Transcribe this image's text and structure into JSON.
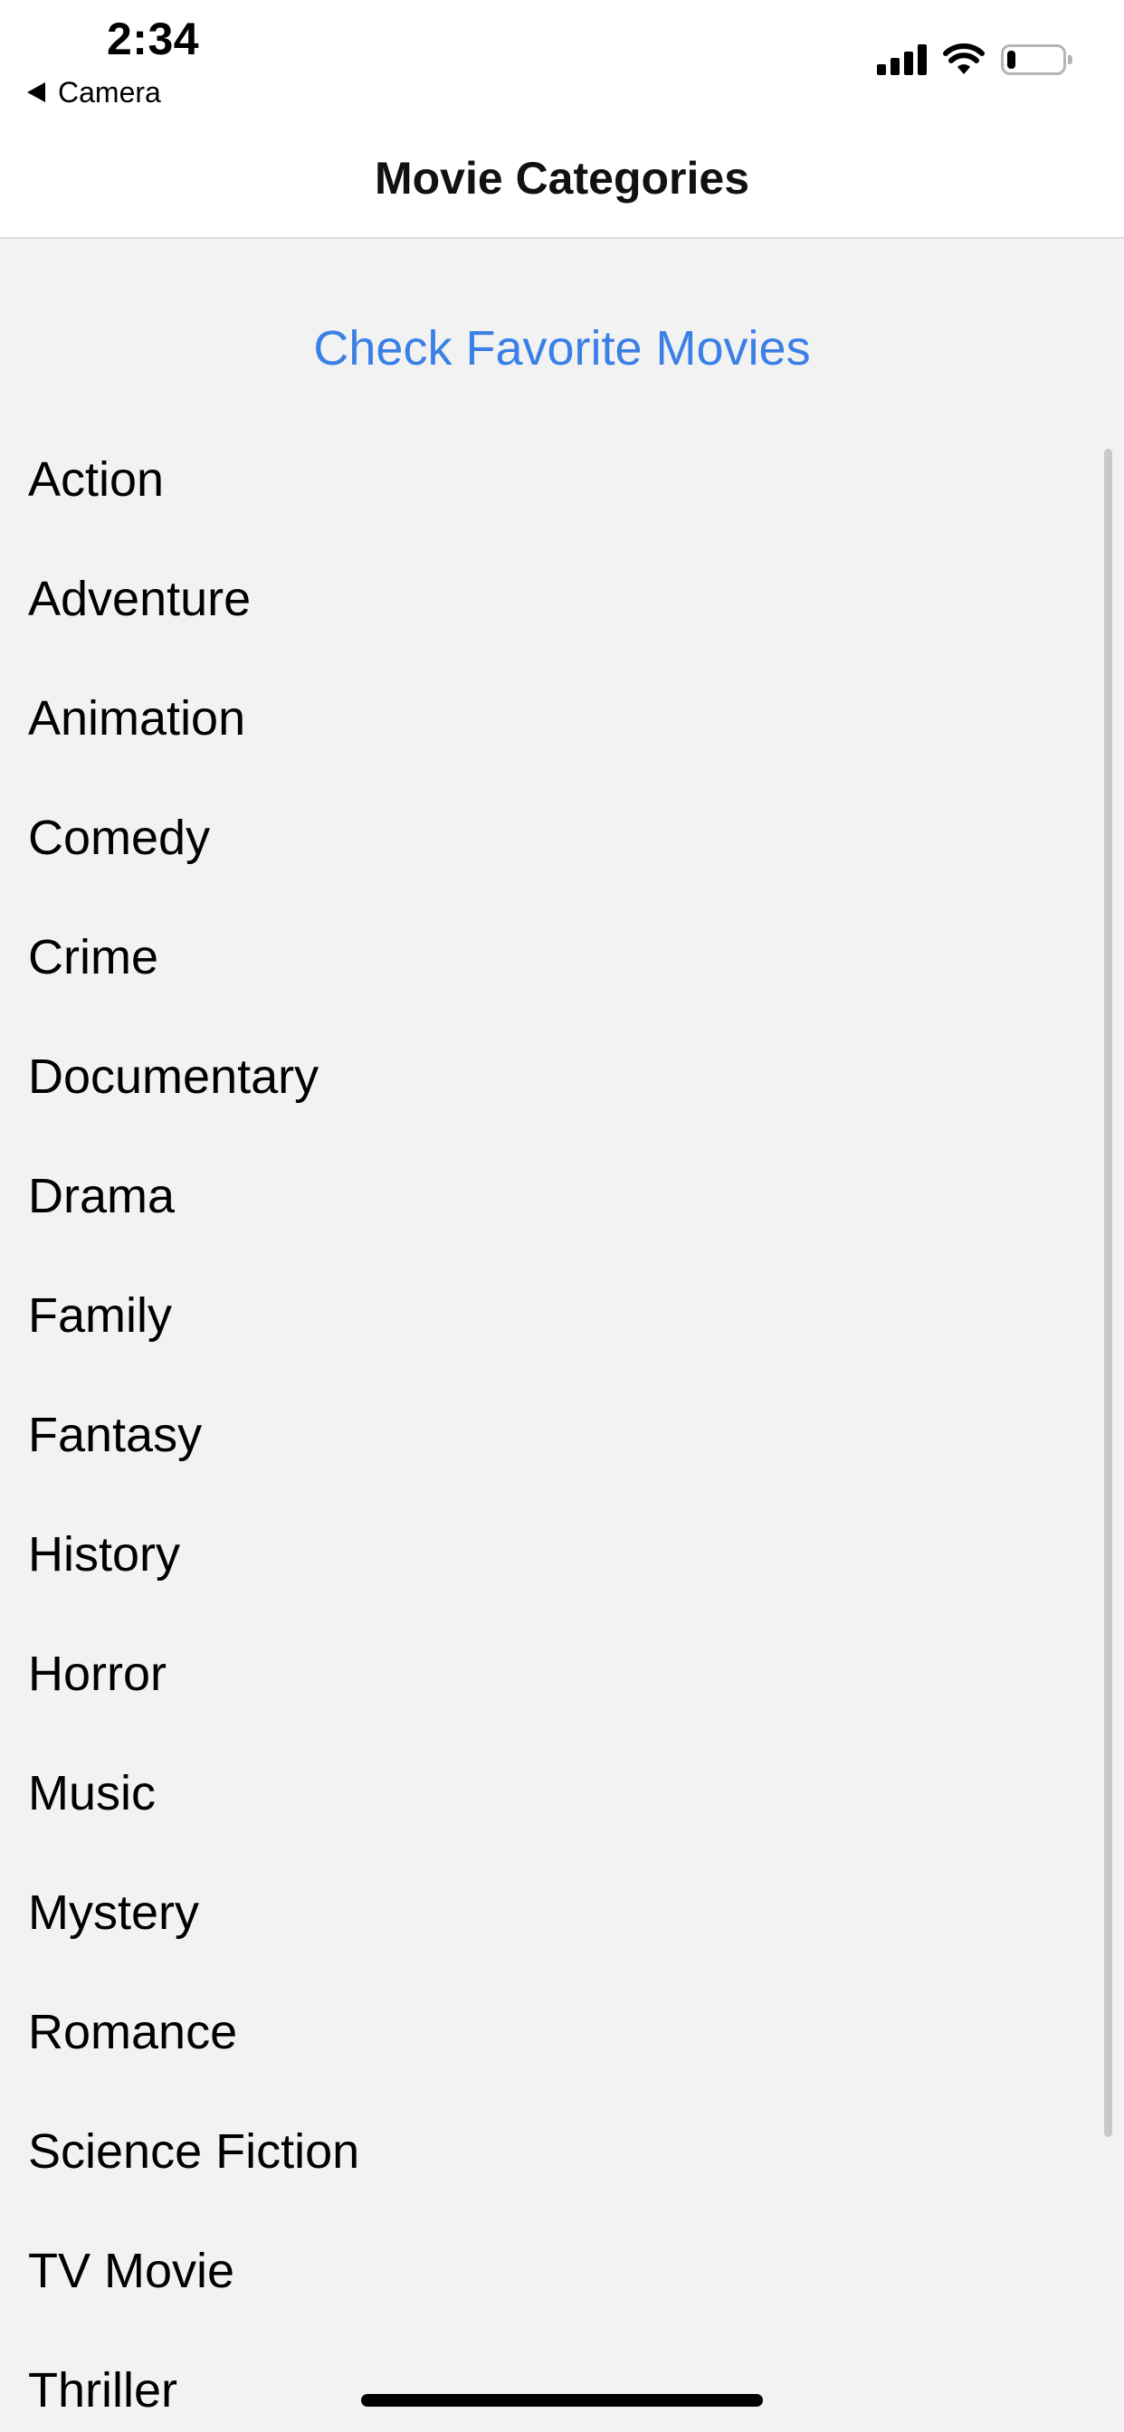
{
  "status_bar": {
    "time": "2:34",
    "back_label": "Camera",
    "signal_icon": "cellular-signal-icon",
    "wifi_icon": "wifi-icon",
    "battery_icon": "battery-icon",
    "battery_level": 0.15
  },
  "nav": {
    "title": "Movie Categories"
  },
  "main": {
    "favorites_link": "Check Favorite Movies",
    "link_color": "#3a80e6",
    "categories": [
      "Action",
      "Adventure",
      "Animation",
      "Comedy",
      "Crime",
      "Documentary",
      "Drama",
      "Family",
      "Fantasy",
      "History",
      "Horror",
      "Music",
      "Mystery",
      "Romance",
      "Science Fiction",
      "TV Movie",
      "Thriller"
    ]
  }
}
